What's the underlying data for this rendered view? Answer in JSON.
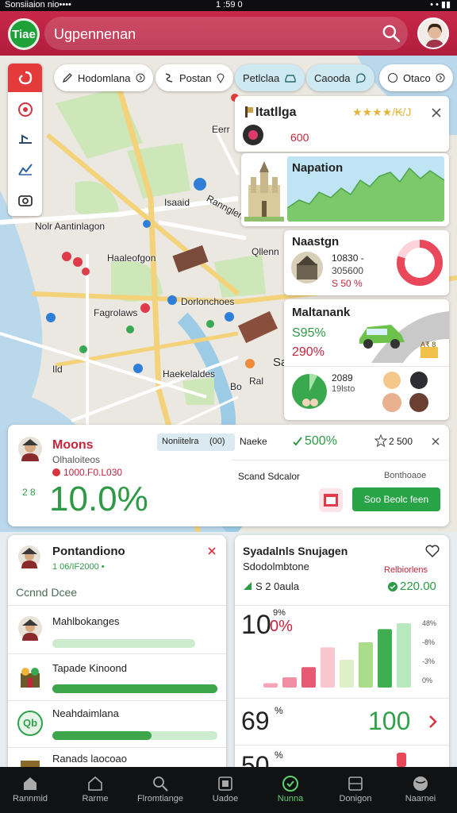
{
  "status_bar": {
    "left": "Sonsiiaion nio••••",
    "center": "1 :59 0",
    "right": "• • ▮▮"
  },
  "header": {
    "logo_text": "Tiae",
    "search_text": "Ugpennenan"
  },
  "chips": [
    {
      "label": "Hodomlana"
    },
    {
      "label": "Postan"
    },
    {
      "label": "Petlclaa"
    },
    {
      "label": "Caooda"
    },
    {
      "label": "Otaco"
    }
  ],
  "map_labels": [
    "Nolr Aantinlagon",
    "Eerr",
    "Isaaid",
    "Haaleofgon",
    "Dorlonchoes",
    "Fagrolaws",
    "Rannglerd",
    "Haekelaldes",
    "Qllenn",
    "Ild",
    "Ral",
    "Bo",
    "Sa"
  ],
  "info_card": {
    "title": "Itatllga",
    "stars": "★★★★/₭/J",
    "value": "600"
  },
  "napation_card": {
    "title": "Napation"
  },
  "naastgn_card": {
    "title": "Naastgn",
    "line1": "10830 -",
    "line2": "305600",
    "line3": "S 50 %"
  },
  "mal_card": {
    "title": "Maltanank",
    "pct1": "S95%",
    "pct2": "290%",
    "badge": "A₹ 8",
    "stat1": "2089",
    "stat2": "19lsto"
  },
  "metric_card": {
    "title": "Moons",
    "sub": "Olhaloiteos",
    "code": "1000.F0.L030",
    "big": "10.0%",
    "mini": "2 8",
    "tag": "Noniitelra",
    "tag_num": "(00)",
    "narke": "Naeke",
    "pct": "500%",
    "star_val": "2 500",
    "desc": "Scand Sdcalor",
    "desc2": "Bonthoaoe",
    "button": "Soo Beolc feen"
  },
  "left_panel": {
    "title": "Pontandiono",
    "sub": "1 06/IF2000 •",
    "section": "Ccnnd Dcee",
    "items": [
      {
        "label": "Mahlbokanges",
        "progress": 0.76
      },
      {
        "label": "Tapade Kinoond",
        "progress": 1.0
      },
      {
        "label": "Neahdaimlana",
        "progress": 0.6
      },
      {
        "label": "Ranads laocoao",
        "progress": 0.4
      }
    ],
    "badge_text": "Qb"
  },
  "right_panel": {
    "title": "Syadalnls Snujagen",
    "sub": "Sdodolmbtone",
    "stat_left": "S 2 0aula",
    "stat_right_label": "Relbiorlens",
    "stat_right_val": "220.00",
    "big1": "10",
    "big1_sub": "0%",
    "big1_sup": "9%",
    "big2": "69",
    "big2_sup": "%",
    "big3": "50",
    "big3_sup": "%",
    "big_green": "100",
    "chart_data": {
      "type": "bar",
      "values": [
        6,
        14,
        28,
        55,
        38,
        62,
        80,
        88
      ],
      "ylim": [
        0,
        100
      ],
      "colors": [
        "#f4a6b8",
        "#f08ea4",
        "#e65a73",
        "#f7c6cf",
        "#dff0c8",
        "#a9dd8a",
        "#3fad52",
        "#b8e8be"
      ],
      "ytick_labels": [
        "48%",
        "-8%",
        "-3%",
        "0%"
      ]
    }
  },
  "bottom_nav": [
    {
      "label": "Rannmid",
      "icon": "home-icon"
    },
    {
      "label": "Rarme",
      "icon": "house-outline-icon"
    },
    {
      "label": "Flromtiange",
      "icon": "search-icon"
    },
    {
      "label": "Uadoe",
      "icon": "media-icon"
    },
    {
      "label": "Nunna",
      "icon": "check-circle-icon"
    },
    {
      "label": "Donigon",
      "icon": "grid-icon"
    },
    {
      "label": "Naarnei",
      "icon": "globe-icon"
    }
  ],
  "colors": {
    "header": "#bd2343",
    "accent_green": "#2fa34a",
    "accent_red": "#e23a47",
    "map_water": "#b9d8ec",
    "map_park": "#cde7b8"
  }
}
